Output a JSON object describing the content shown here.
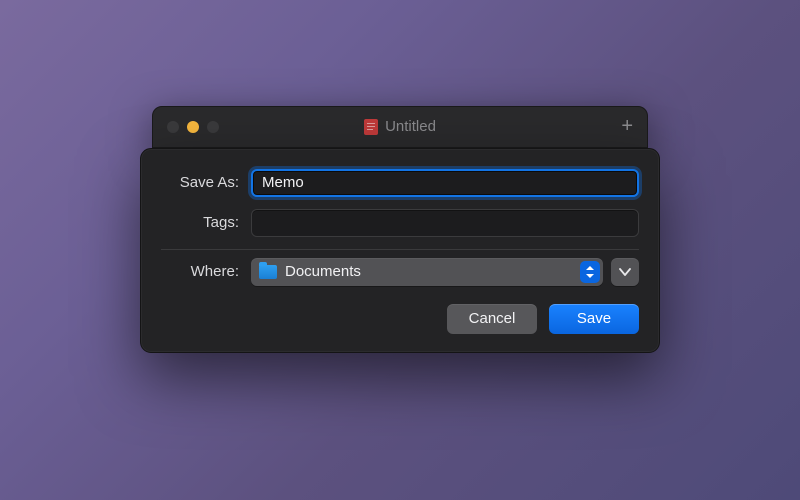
{
  "parent_window": {
    "title": "Untitled",
    "close_color": "#3a3a3c",
    "minimize_color": "#f6b73e",
    "maximize_color": "#3a3a3c"
  },
  "sheet": {
    "save_as_label": "Save As:",
    "save_as_value": "Memo",
    "tags_label": "Tags:",
    "tags_value": "",
    "where_label": "Where:",
    "where_value": "Documents",
    "cancel_label": "Cancel",
    "save_label": "Save",
    "accent_color": "#0a66e0"
  }
}
